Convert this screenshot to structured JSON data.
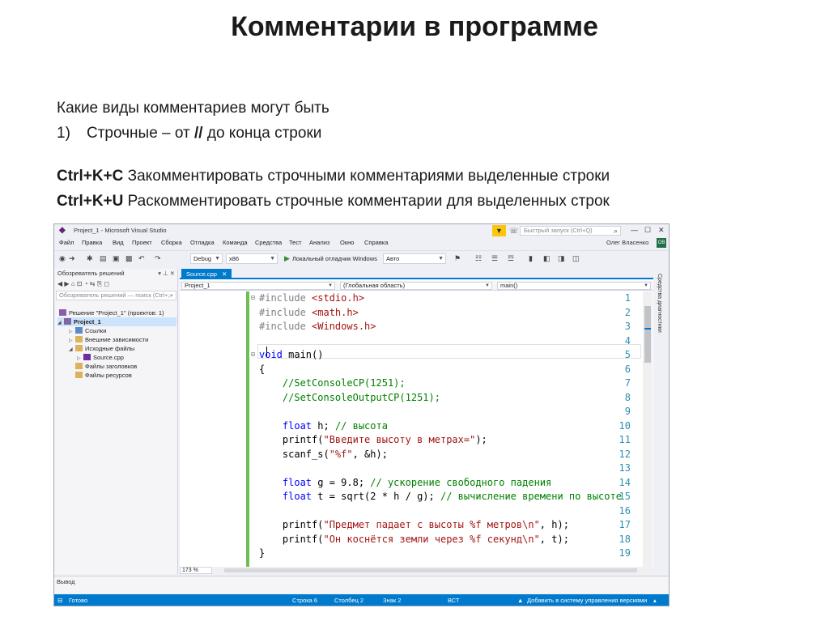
{
  "slide": {
    "title": "Комментарии в программе",
    "line1": "Какие виды комментариев могут быть",
    "item_num": "1)",
    "item_text_a": "Строчные – от ",
    "item_bold": "//",
    "item_text_b": " до конца строки",
    "shortcut1_key": "Ctrl+K+C",
    "shortcut1_desc": " Закомментировать строчными комментариями выделенные строки",
    "shortcut2_key": "Ctrl+K+U",
    "shortcut2_desc": " Раскомментировать строчные комментарии для выделенных строк"
  },
  "vs": {
    "window_title": "Project_1 - Microsoft Visual Studio",
    "quick_launch_placeholder": "Быстрый запуск (Ctrl+Q)",
    "menu": [
      "Файл",
      "Правка",
      "Вид",
      "Проект",
      "Сборка",
      "Отладка",
      "Команда",
      "Средства",
      "Тест",
      "Анализ",
      "Окно",
      "Справка"
    ],
    "user": "Олег Власенко",
    "user_initials": "OB",
    "config": "Debug",
    "platform": "x86",
    "run_label": "Локальный отладчик Windows",
    "run_mode": "Авто",
    "solution_explorer": {
      "title": "Обозреватель решений",
      "search_placeholder": "Обозреватель решений — поиск (Ctrl+;",
      "items": [
        {
          "label": "Решение \"Project_1\" (проектов: 1)"
        },
        {
          "label": "Project_1"
        },
        {
          "label": "Ссылки"
        },
        {
          "label": "Внешние зависимости"
        },
        {
          "label": "Исходные файлы"
        },
        {
          "label": "Source.cpp"
        },
        {
          "label": "Файлы заголовков"
        },
        {
          "label": "Файлы ресурсов"
        }
      ]
    },
    "tab": "Source.cpp",
    "nav": {
      "project": "Project_1",
      "scope": "(Глобальная область)",
      "member": "main()"
    },
    "right_panel": "Средства диагностики",
    "zoom": "173 %",
    "output_title": "Вывод",
    "status": {
      "ready": "Готово",
      "line": "Строка 6",
      "col": "Столбец 2",
      "ch": "Знак 2",
      "mode": "ВСТ",
      "vcs": "Добавить в систему управления версиями"
    }
  }
}
